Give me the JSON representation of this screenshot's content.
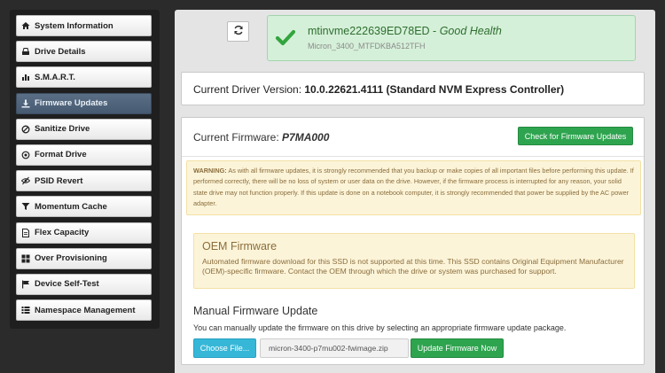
{
  "sidebar": {
    "items": [
      {
        "label": "System Information",
        "icon": "home-icon",
        "active": false
      },
      {
        "label": "Drive Details",
        "icon": "drive-icon",
        "active": false
      },
      {
        "label": "S.M.A.R.T.",
        "icon": "bar-chart-icon",
        "active": false
      },
      {
        "label": "Firmware Updates",
        "icon": "download-icon",
        "active": true
      },
      {
        "label": "Sanitize Drive",
        "icon": "ban-icon",
        "active": false
      },
      {
        "label": "Format Drive",
        "icon": "target-icon",
        "active": false
      },
      {
        "label": "PSID Revert",
        "icon": "eye-slash-icon",
        "active": false
      },
      {
        "label": "Momentum Cache",
        "icon": "filter-icon",
        "active": false
      },
      {
        "label": "Flex Capacity",
        "icon": "document-icon",
        "active": false
      },
      {
        "label": "Over Provisioning",
        "icon": "grid-icon",
        "active": false
      },
      {
        "label": "Device Self-Test",
        "icon": "flag-icon",
        "active": false
      },
      {
        "label": "Namespace Management",
        "icon": "list-icon",
        "active": false
      }
    ]
  },
  "health": {
    "drive_name": "mtinvme222639ED78ED",
    "separator": " - ",
    "status": "Good Health",
    "model": "Micron_3400_MTFDKBA512TFH",
    "status_color": "#2e6e2f"
  },
  "driver": {
    "label": "Current Driver Version: ",
    "value": "10.0.22621.4111 (Standard NVM Express Controller)"
  },
  "firmware": {
    "label": "Current Firmware: ",
    "value": "P7MA000",
    "check_button": "Check for Firmware Updates",
    "warning_label": "WARNING:",
    "warning_text": " As with all firmware updates, it is strongly recommended that you backup or make copies of all important files before performing this update. If performed correctly, there will be no loss of system or user data on the drive. However, if the firmware process is interrupted for any reason, your solid state drive may not function properly. If this update is done on a notebook computer, it is strongly recommended that power be supplied by the AC power adapter.",
    "oem_title": "OEM Firmware",
    "oem_text": "Automated firmware download for this SSD is not supported at this time. This SSD contains Original Equipment Manufacturer (OEM)-specific firmware. Contact the OEM through which the drive or system was purchased for support.",
    "manual_title": "Manual Firmware Update",
    "manual_desc": "You can manually update the firmware on this drive by selecting an appropriate firmware update package.",
    "choose_button": "Choose File...",
    "file_name": "micron-3400-p7mu002-fwimage.zip",
    "update_button": "Update Firmware Now"
  },
  "colors": {
    "accent_green": "#2ea44f",
    "info_blue": "#36b7d8",
    "sidebar_active": "#4f637a"
  }
}
